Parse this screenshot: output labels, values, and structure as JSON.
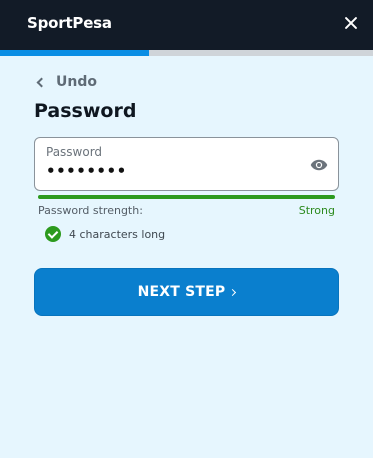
{
  "header": {
    "logo_text": "SportPesa",
    "progress": 0.4
  },
  "nav": {
    "undo_label": "Undo"
  },
  "form": {
    "title": "Password",
    "password": {
      "label": "Password",
      "value": "••••••••",
      "toggle_icon": "eye-icon"
    },
    "strength": {
      "label": "Password strength:",
      "value": "Strong",
      "color": "#2c9a1e"
    },
    "rules": [
      {
        "text": "4 characters long",
        "status": "met"
      }
    ],
    "next_button_label": "NEXT STEP"
  },
  "colors": {
    "header_bg": "#121b27",
    "page_bg": "#e6f6fe",
    "accent": "#0a7fce",
    "success": "#2c9a1e"
  }
}
